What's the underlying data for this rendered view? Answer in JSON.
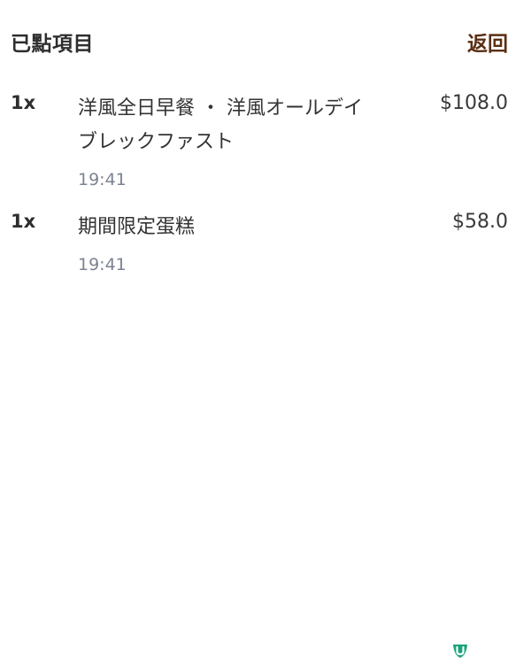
{
  "header": {
    "title": "已點項目",
    "back_label": "返回"
  },
  "orders": [
    {
      "quantity": "1x",
      "name": "洋風全日早餐 ・ 洋風オールデイブレックファスト",
      "time": "19:41",
      "price": "$108.0"
    },
    {
      "quantity": "1x",
      "name": "期間限定蛋糕",
      "time": "19:41",
      "price": "$58.0"
    }
  ],
  "colors": {
    "accent": "#5a2e12",
    "time_text": "#7b8391",
    "brand_green": "#1aa37a"
  },
  "icons": {
    "brand": "brand-logo-icon"
  }
}
